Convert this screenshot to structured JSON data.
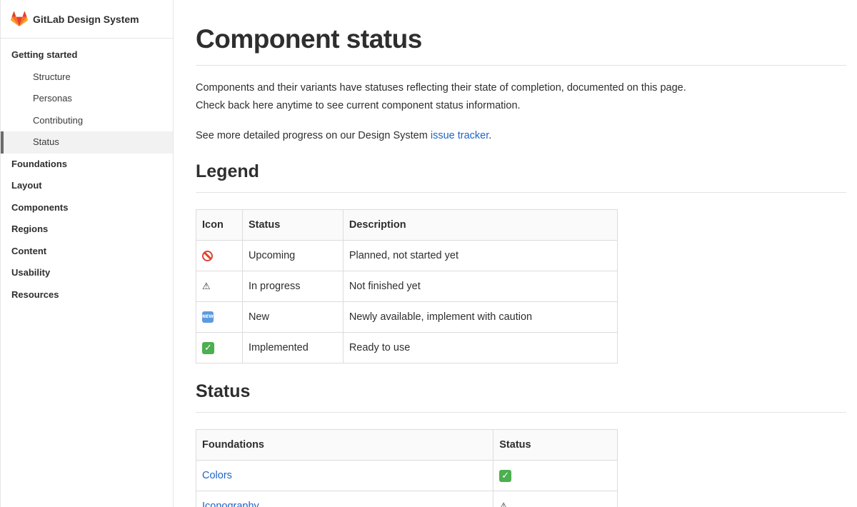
{
  "sidebar": {
    "brand": "GitLab Design System",
    "items": [
      {
        "label": "Getting started"
      },
      {
        "label": "Structure"
      },
      {
        "label": "Personas"
      },
      {
        "label": "Contributing"
      },
      {
        "label": "Status"
      },
      {
        "label": "Foundations"
      },
      {
        "label": "Layout"
      },
      {
        "label": "Components"
      },
      {
        "label": "Regions"
      },
      {
        "label": "Content"
      },
      {
        "label": "Usability"
      },
      {
        "label": "Resources"
      }
    ],
    "active_item": "Status"
  },
  "page": {
    "title": "Component status",
    "intro_line1": "Components and their variants have statuses reflecting their state of completion, documented on this page.",
    "intro_line2": "Check back here anytime to see current component status information.",
    "tracker_prefix": "See more detailed progress on our Design System ",
    "tracker_link": "issue tracker",
    "tracker_suffix": "."
  },
  "legend": {
    "heading": "Legend",
    "headers": {
      "icon": "Icon",
      "status": "Status",
      "description": "Description"
    },
    "rows": [
      {
        "icon": "no-entry-icon",
        "status": "Upcoming",
        "description": "Planned, not started yet"
      },
      {
        "icon": "warning-icon",
        "status": "In progress",
        "description": "Not finished yet"
      },
      {
        "icon": "new-badge-icon",
        "status": "New",
        "description": "Newly available, implement with caution"
      },
      {
        "icon": "check-mark-icon",
        "status": "Implemented",
        "description": "Ready to use"
      }
    ]
  },
  "status": {
    "heading": "Status",
    "headers": {
      "foundations": "Foundations",
      "status": "Status"
    },
    "rows": [
      {
        "name": "Colors",
        "icon": "check-mark-icon"
      },
      {
        "name": "Iconography",
        "icon": "warning-icon"
      }
    ]
  },
  "icons": {
    "new_badge_text": "NEW",
    "warning_glyph": "⚠",
    "check_glyph": "✓"
  },
  "colors": {
    "link": "#1f63c8",
    "upcoming": "#e0432d",
    "implemented": "#4caf50",
    "new": "#5b9be0"
  }
}
